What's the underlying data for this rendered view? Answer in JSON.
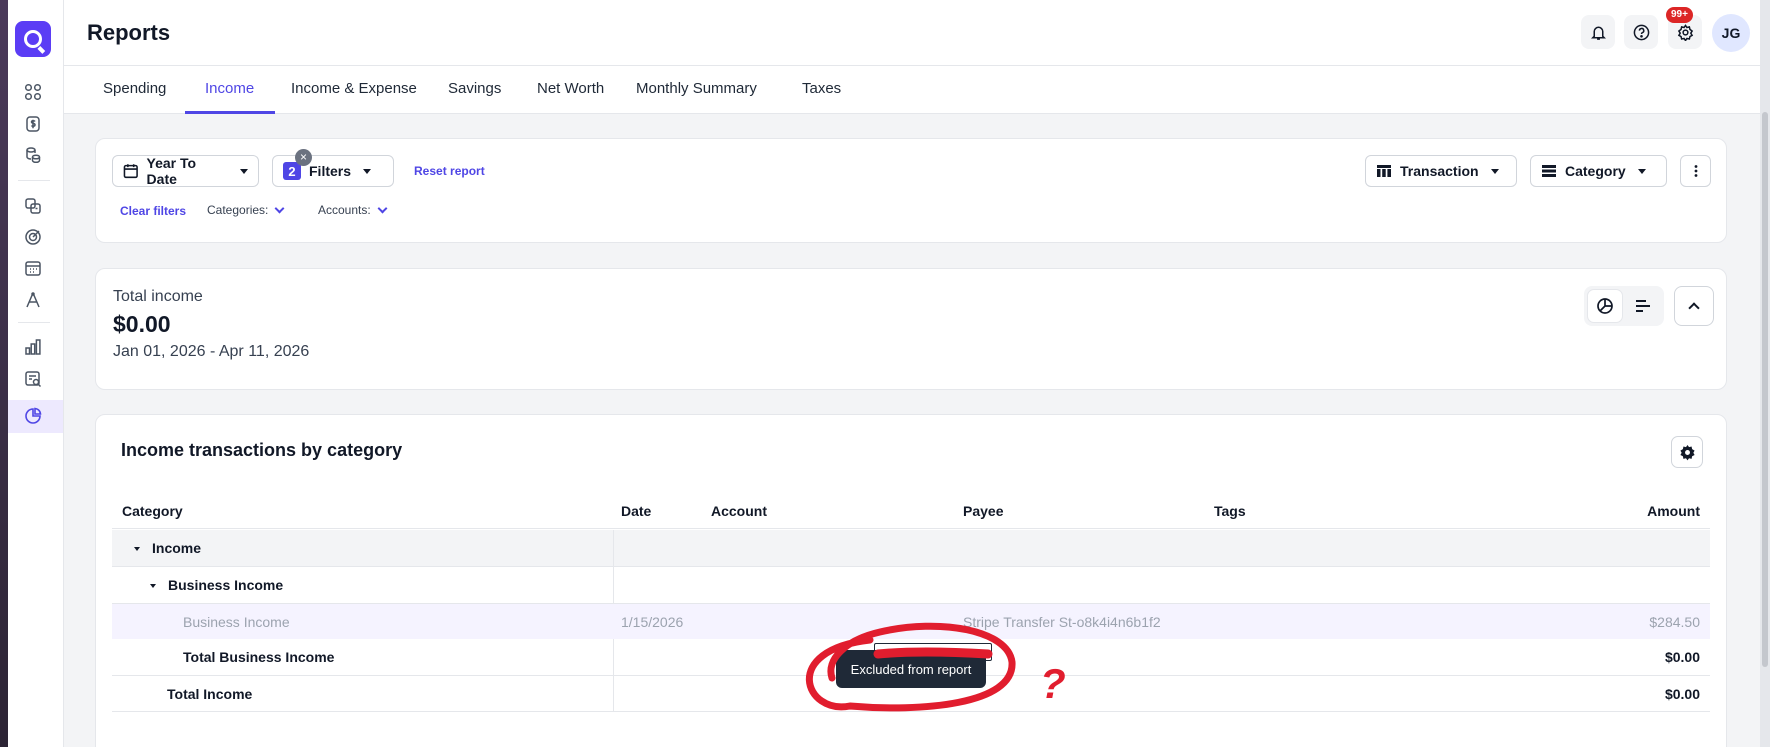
{
  "header": {
    "title": "Reports",
    "notification_badge": "99+",
    "avatar_initials": "JG"
  },
  "tabs": [
    "Spending",
    "Income",
    "Income & Expense",
    "Savings",
    "Net Worth",
    "Monthly Summary",
    "Taxes"
  ],
  "active_tab": "Income",
  "filters": {
    "date_range": "Year To Date",
    "filter_count": "2",
    "filters_label": "Filters",
    "reset_link": "Reset report",
    "clear_link": "Clear filters",
    "categories_label": "Categories:",
    "accounts_label": "Accounts:",
    "group_by_primary": "Transaction",
    "group_by_secondary": "Category"
  },
  "summary": {
    "label": "Total income",
    "value": "$0.00",
    "range": "Jan 01, 2026 - Apr 11, 2026"
  },
  "table": {
    "title": "Income transactions by category",
    "columns": {
      "category": "Category",
      "date": "Date",
      "account": "Account",
      "payee": "Payee",
      "tags": "Tags",
      "amount": "Amount"
    },
    "rows": {
      "income_group": "Income",
      "business_group": "Business Income",
      "txn_category": "Business Income",
      "txn_date": "1/15/2026",
      "txn_payee": "Stripe Transfer St-o8k4i4n6b1f2",
      "txn_amount": "$284.50",
      "total_business_label": "Total Business Income",
      "total_business_amount": "$0.00",
      "total_income_label": "Total Income",
      "total_income_amount": "$0.00"
    }
  },
  "tooltip": "Excluded from report",
  "annotation_mark": "?",
  "colors": {
    "brand": "#5b3df5",
    "accent": "#4f46e5",
    "annotation": "#e11d2e"
  }
}
